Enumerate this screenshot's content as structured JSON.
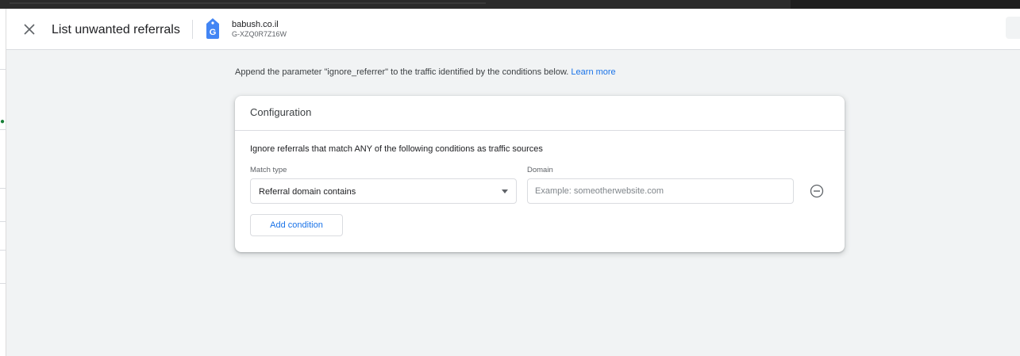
{
  "header": {
    "close_icon": "close-icon",
    "title": "List unwanted referrals",
    "property": {
      "icon": "analytics-property-tag-icon",
      "icon_letter": "G",
      "name": "babush.co.il",
      "id": "G-XZQ0R7Z16W"
    }
  },
  "description": {
    "text": "Append the parameter \"ignore_referrer\" to the traffic identified by the conditions below.",
    "link": "Learn more"
  },
  "configuration": {
    "title": "Configuration",
    "subtitle": "Ignore referrals that match ANY of the following conditions as traffic sources",
    "conditions": [
      {
        "match_type_label": "Match type",
        "match_type_value": "Referral domain contains",
        "domain_label": "Domain",
        "domain_value": "",
        "domain_placeholder": "Example: someotherwebsite.com",
        "remove_icon": "remove-circle-icon"
      }
    ],
    "add_condition_label": "Add condition"
  },
  "colors": {
    "accent": "#1a73e8",
    "panel_bg": "#f1f3f4",
    "property_icon": "#4285f4"
  }
}
